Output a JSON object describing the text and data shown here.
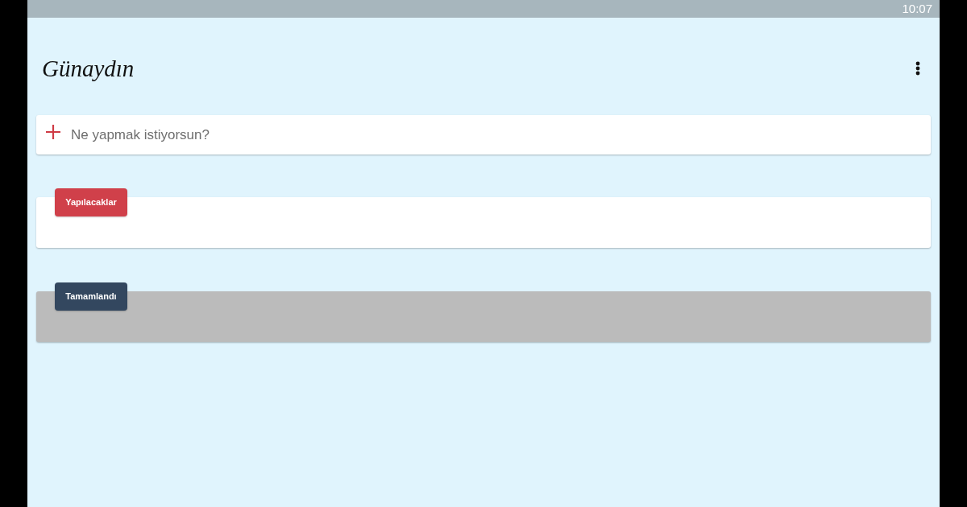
{
  "status_bar": {
    "time": "10:07"
  },
  "header": {
    "title": "Günaydın"
  },
  "new_task": {
    "placeholder": "Ne yapmak istiyorsun?"
  },
  "sections": [
    {
      "label": "Yapılacaklar",
      "kind": "todo"
    },
    {
      "label": "Tamamlandı",
      "kind": "done"
    }
  ]
}
